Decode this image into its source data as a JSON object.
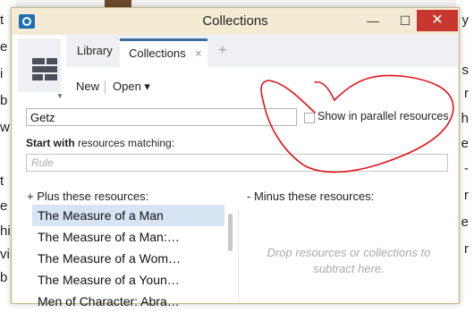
{
  "window": {
    "title": "Collections",
    "minimize": "—",
    "maximize": "☐",
    "close": "✕"
  },
  "tabs": [
    {
      "label": "Library"
    },
    {
      "label": "Collections",
      "close": "×"
    }
  ],
  "tab_add": "+",
  "toolbar": {
    "new_label": "New",
    "open_label": "Open ▾",
    "side_dropdown": "▼"
  },
  "search": {
    "value": "Getz"
  },
  "parallel": {
    "label": "Show in parallel resources",
    "checked": false
  },
  "rule_section": {
    "bold": "Start with",
    "rest": " resources matching:",
    "placeholder": "Rule"
  },
  "plus_heading": "+  Plus these resources:",
  "minus_heading": "-  Minus these resources:",
  "resources": [
    {
      "label": "The Measure of a Man",
      "selected": true
    },
    {
      "label": "The Measure of a Man:…",
      "selected": false
    },
    {
      "label": "The Measure of a Wom…",
      "selected": false
    },
    {
      "label": "The Measure of a Youn…",
      "selected": false
    },
    {
      "label": "Men of Character: Abra…",
      "selected": false
    }
  ],
  "drop_hint": "Drop resources or collections to subtract here.",
  "background": {
    "left_chars": [
      "t",
      "e",
      "i",
      "b",
      "w",
      "t",
      "e",
      "hi",
      "vil",
      "b"
    ],
    "right_chars": [
      "y",
      "s",
      "r",
      "h",
      "e",
      "-",
      "r",
      "e",
      "r"
    ]
  },
  "colors": {
    "window_bg": "#f3ebd4",
    "accent": "#3a6ea5",
    "selected_row": "#d6e4f4",
    "close_btn": "#c7372f",
    "annotation": "#e0151a"
  }
}
